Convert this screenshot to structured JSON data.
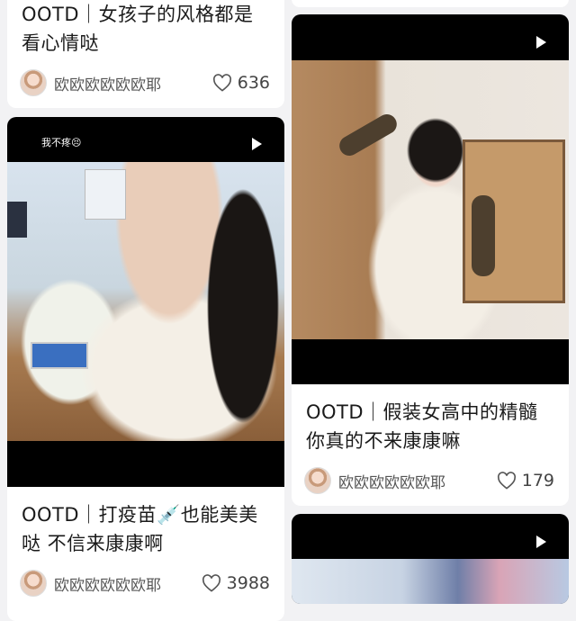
{
  "cards": [
    {
      "title": "OOTD｜女孩子的风格都是\n看心情哒",
      "author": "欧欧欧欧欧欧耶",
      "likes": "636"
    },
    {
      "overlay_text": "我不疼😣",
      "title": "OOTD｜打疫苗💉也能美美\n哒 不信来康康啊",
      "author": "欧欧欧欧欧欧耶",
      "likes": "3988"
    },
    {
      "title": "OOTD｜假装女高中的精髓\n你真的不来康康嘛",
      "author": "欧欧欧欧欧欧耶",
      "likes": "179"
    },
    {}
  ],
  "icons": {
    "like": "heart-outline-icon",
    "play": "play-icon"
  }
}
